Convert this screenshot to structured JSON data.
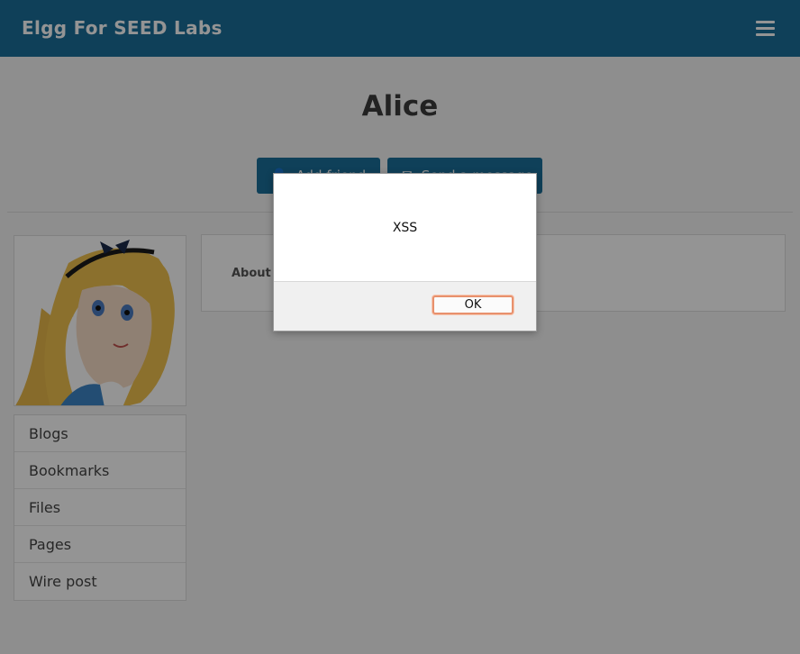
{
  "header": {
    "site_title": "Elgg For SEED Labs",
    "menu_icon": "hamburger-menu-icon"
  },
  "profile": {
    "name": "Alice",
    "add_friend_label": "Add friend",
    "send_message_label": "Send a message",
    "about_label": "About me"
  },
  "sidebar": {
    "items": [
      {
        "label": "Blogs"
      },
      {
        "label": "Bookmarks"
      },
      {
        "label": "Files"
      },
      {
        "label": "Pages"
      },
      {
        "label": "Wire post"
      }
    ]
  },
  "alert": {
    "message": "XSS",
    "ok_label": "OK"
  },
  "colors": {
    "header_bg": "#1b6f99",
    "button_bg": "#1b6f99",
    "ok_border": "#e8916d"
  }
}
